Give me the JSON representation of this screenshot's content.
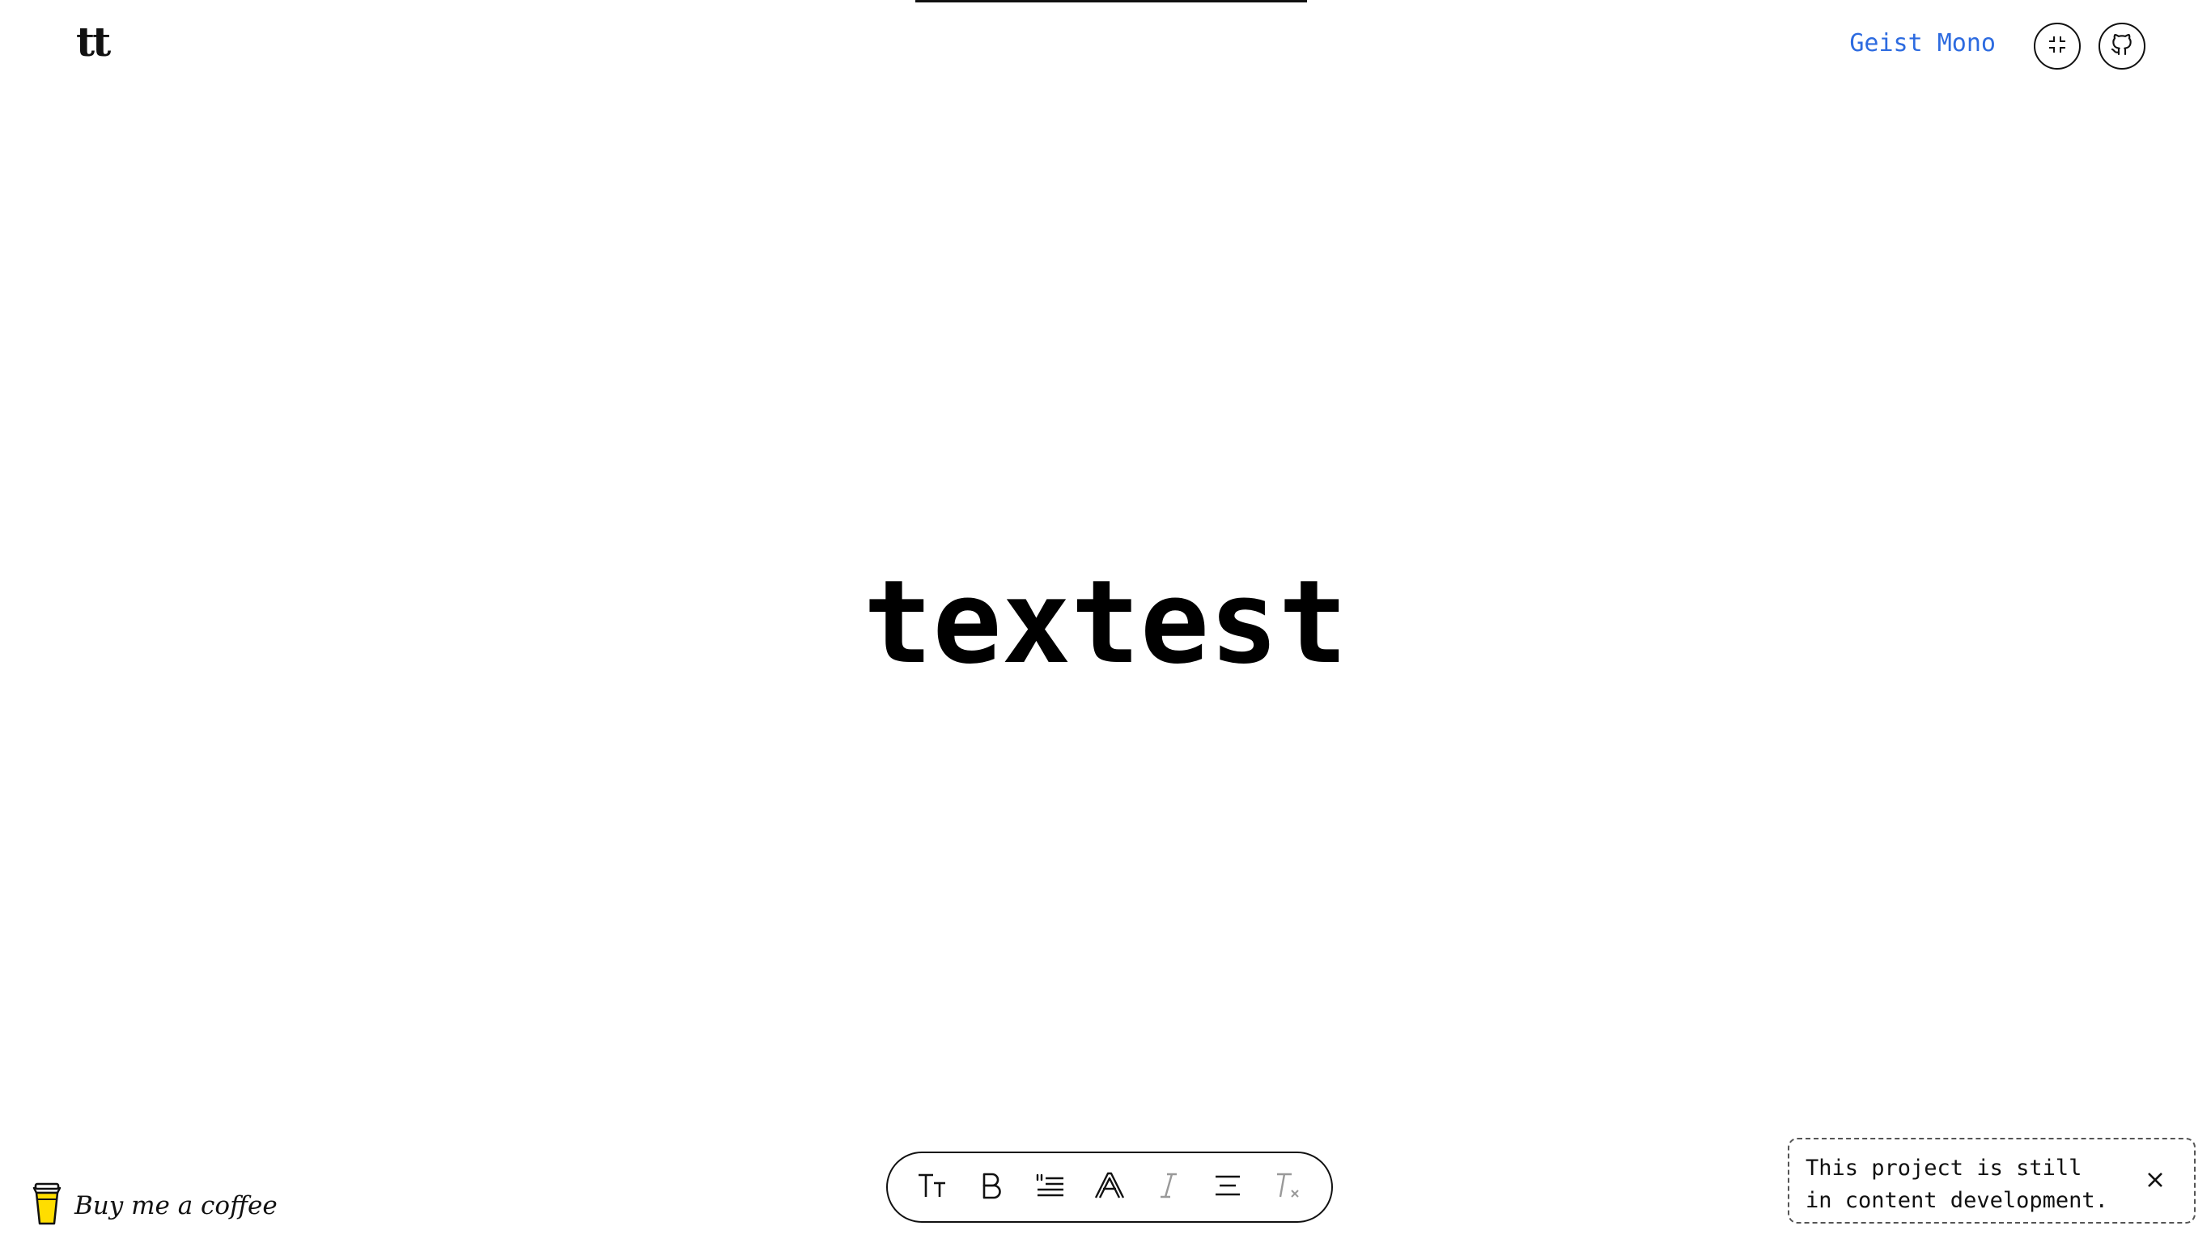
{
  "header": {
    "logo_text": "tt",
    "font_name": "Geist Mono",
    "collapse_icon": "collapse-icon",
    "github_icon": "github-icon"
  },
  "main": {
    "sample_text": "textest"
  },
  "coffee": {
    "icon": "coffee-cup-icon",
    "label": "Buy me a coffee"
  },
  "toolbar": {
    "tools": [
      {
        "icon": "text-size-icon"
      },
      {
        "icon": "bold-icon"
      },
      {
        "icon": "quote-list-icon"
      },
      {
        "icon": "font-outline-icon"
      },
      {
        "icon": "italic-icon"
      },
      {
        "icon": "align-center-icon"
      },
      {
        "icon": "clear-format-icon"
      }
    ]
  },
  "toast": {
    "message": "This project is still\nin content development.",
    "close_icon": "close-icon"
  },
  "colors": {
    "accent": "#2d6be0",
    "text": "#111111",
    "background": "#ffffff",
    "coffee_yellow": "#ffdd00"
  }
}
